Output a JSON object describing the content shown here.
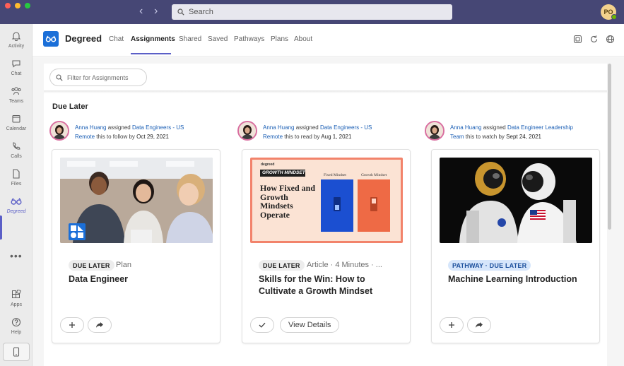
{
  "window": {
    "search_label": "Search",
    "user_initials": "PO"
  },
  "rail": {
    "items": [
      {
        "label": "Activity"
      },
      {
        "label": "Chat"
      },
      {
        "label": "Teams"
      },
      {
        "label": "Calendar"
      },
      {
        "label": "Calls"
      },
      {
        "label": "Files"
      },
      {
        "label": "Degreed"
      },
      {
        "label": "Apps"
      },
      {
        "label": "Help"
      }
    ],
    "more": "•••"
  },
  "app": {
    "name": "Degreed",
    "tabs": [
      "Chat",
      "Assignments",
      "Shared",
      "Saved",
      "Pathways",
      "Plans",
      "About"
    ],
    "active_tab": "Assignments"
  },
  "filter": {
    "placeholder": "Filter for Assignments"
  },
  "section": {
    "title": "Due Later"
  },
  "cards": [
    {
      "assigner": "Anna Huang",
      "verb": " assigned ",
      "group_line1": "Data Engineers - US",
      "group_line2": "Remote",
      "action": " this to follow by ",
      "date": "Oct 29, 2021",
      "badge": "DUE LATER",
      "meta": "Plan",
      "title": "Data Engineer",
      "buttons": []
    },
    {
      "assigner": "Anna Huang",
      "verb": " assigned ",
      "group_line1": "Data Engineers - US",
      "group_line2": "Remote",
      "action": " this to read by ",
      "date": "Aug 1, 2021",
      "badge": "DUE LATER",
      "meta": "Article · 4 Minutes · ...",
      "title": "Skills for the Win: How to Cultivate a Growth Mindset",
      "view_details": "View Details",
      "image_text": {
        "brand": "degreed",
        "tag": "GROWTH MINDSET",
        "headline": "How Fixed and Growth Mindsets Operate",
        "fixed": "Fixed Mindset",
        "growth": "Growth Mindset"
      }
    },
    {
      "assigner": "Anna Huang",
      "verb": " assigned ",
      "group_line1": "Data Engineer Leadership",
      "group_line2": "Team",
      "action": " this to watch by ",
      "date": "Sept 24, 2021",
      "badge": "PATHWAY · DUE LATER",
      "meta": "",
      "title": "Machine Learning Introduction"
    }
  ],
  "colors": {
    "titlebar": "#464775",
    "accent": "#5b5fc7",
    "link": "#1b5fb5",
    "brand": "#1b6fd8"
  }
}
